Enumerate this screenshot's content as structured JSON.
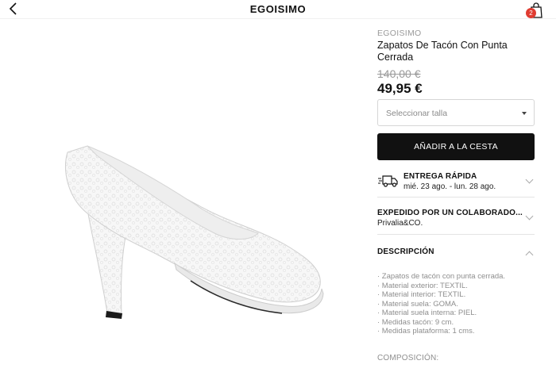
{
  "header": {
    "title": "EGOISIMO",
    "cart_count": "2",
    "back_icon": "chevron-left-icon",
    "bag_icon": "shopping-bag-icon",
    "badge_color": "#e03c31"
  },
  "gallery": {
    "image_count": 4,
    "active_index": 0
  },
  "product": {
    "brand": "EGOISIMO",
    "name": "Zapatos De Tacón Con Punta Cerrada",
    "old_price": "140,00 €",
    "price": "49,95 €"
  },
  "size_select": {
    "placeholder": "Seleccionar talla"
  },
  "add_to_cart": {
    "label": "AÑADIR A LA CESTA"
  },
  "delivery": {
    "title": "ENTREGA RÁPIDA",
    "dates": "mié. 23 ago. - lun. 28 ago.",
    "icon": "truck-icon"
  },
  "seller": {
    "title": "EXPEDIDO POR UN COLABORADO...",
    "name": "Privalia&CO."
  },
  "description": {
    "title": "DESCRIPCIÓN",
    "items": [
      "· Zapatos de tacón con punta cerrada.",
      "· Material exterior: TEXTIL.",
      "· Material interior: TEXTIL.",
      "· Material suela: GOMA.",
      "· Material suela interna: PIEL.",
      "· Medidas tacón: 9 cm.",
      "· Medidas plataforma: 1 cms."
    ]
  },
  "composition": {
    "title": "COMPOSICIÓN:"
  }
}
